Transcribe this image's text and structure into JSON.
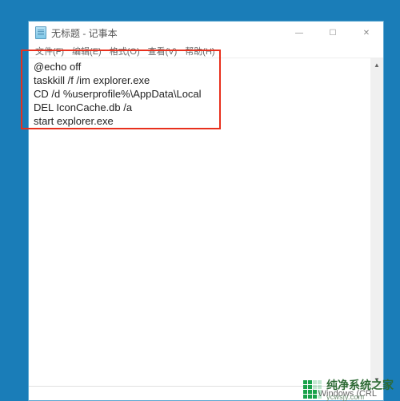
{
  "window": {
    "title": "无标题 - 记事本",
    "minimize": "—",
    "maximize": "☐",
    "close": "✕"
  },
  "menu": {
    "file": "文件(F)",
    "edit": "编辑(E)",
    "format": "格式(O)",
    "view": "查看(V)",
    "help": "帮助(H)"
  },
  "content": {
    "text": "@echo off\ntaskkill /f /im explorer.exe\nCD /d %userprofile%\\AppData\\Local\nDEL IconCache.db /a\nstart explorer.exe"
  },
  "status": {
    "encoding": "Windows (CRL"
  },
  "watermark": {
    "title": "纯净系统之家",
    "url": "ycwsjy.com"
  }
}
